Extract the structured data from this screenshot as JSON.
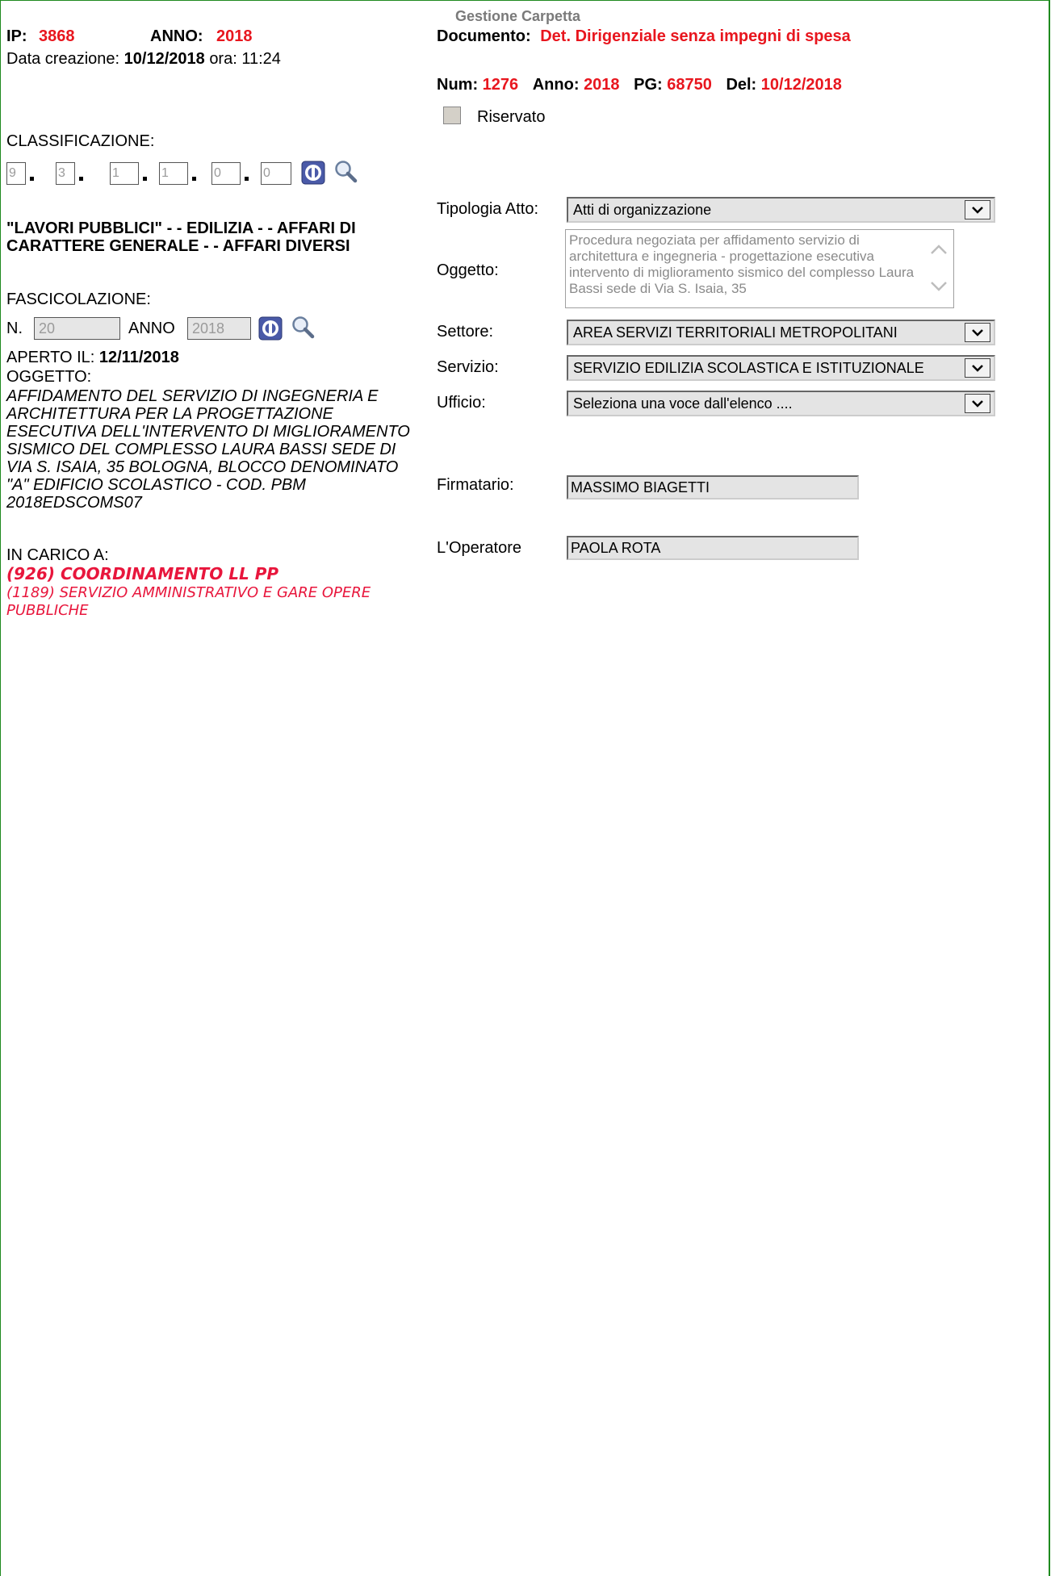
{
  "header": {
    "title": "Gestione Carpetta",
    "ip_label": "IP:",
    "ip_value": "3868",
    "anno_label": "ANNO:",
    "anno_value": "2018",
    "data_creazione_label": "Data creazione:",
    "data_creazione_value": "10/12/2018",
    "ora_label": "ora:",
    "ora_value": "11:24",
    "documento_label": "Documento:",
    "documento_value": "Det. Dirigenziale senza impegni di spesa",
    "num_label": "Num:",
    "num_value": "1276",
    "num_anno_label": "Anno:",
    "num_anno_value": "2018",
    "pg_label": "PG:",
    "pg_value": "68750",
    "del_label": "Del:",
    "del_value": "10/12/2018",
    "riservato_label": "Riservato",
    "riservato_checked": false
  },
  "classificazione": {
    "label": "CLASSIFICAZIONE:",
    "codes": [
      "9",
      "3",
      "1",
      "1",
      "0",
      "0"
    ],
    "description": "\"LAVORI PUBBLICI\" - - EDILIZIA - - AFFARI DI CARATTERE GENERALE - - AFFARI DIVERSI"
  },
  "fascicolazione": {
    "label": "FASCICOLAZIONE:",
    "n_label": "N.",
    "n_value": "20",
    "anno_label": "ANNO",
    "anno_value": "2018",
    "aperto_label": "APERTO IL:",
    "aperto_value": "12/11/2018",
    "oggetto_label": "OGGETTO:",
    "oggetto_value": "AFFIDAMENTO DEL SERVIZIO DI INGEGNERIA E ARCHITETTURA PER LA PROGETTAZIONE ESECUTIVA DELL'INTERVENTO DI MIGLIORAMENTO SISMICO DEL COMPLESSO LAURA BASSI SEDE DI VIA S. ISAIA, 35 BOLOGNA, BLOCCO DENOMINATO \"A\" EDIFICIO SCOLASTICO - COD. PBM 2018EDSCOMS07",
    "in_carico_label": "IN CARICO A:",
    "in_carico_primary": "(926) COORDINAMENTO LL PP",
    "in_carico_secondary": "(1189) SERVIZIO AMMINISTRATIVO E GARE OPERE PUBBLICHE"
  },
  "form": {
    "tipologia_label": "Tipologia Atto:",
    "tipologia_value": "Atti di organizzazione",
    "oggetto_label": "Oggetto:",
    "oggetto_value": "Procedura negoziata per affidamento servizio di architettura e ingegneria - progettazione esecutiva intervento di miglioramento sismico del complesso Laura Bassi sede di Via S. Isaia, 35",
    "settore_label": "Settore:",
    "settore_value": "AREA SERVIZI TERRITORIALI METROPOLITANI",
    "servizio_label": "Servizio:",
    "servizio_value": "SERVIZIO EDILIZIA SCOLASTICA E ISTITUZIONALE",
    "ufficio_label": "Ufficio:",
    "ufficio_value": "Seleziona una voce dall'elenco ....",
    "firmatario_label": "Firmatario:",
    "firmatario_value": "MASSIMO BIAGETTI",
    "operatore_label": "L'Operatore",
    "operatore_value": "PAOLA ROTA"
  },
  "colors": {
    "frame": "#1e8a1e",
    "accent_red": "#e8161e",
    "carico_red": "#e8163c"
  },
  "icons": [
    "clear-icon",
    "search-icon",
    "chevron-down-icon",
    "scroll-up-icon",
    "scroll-down-icon"
  ]
}
